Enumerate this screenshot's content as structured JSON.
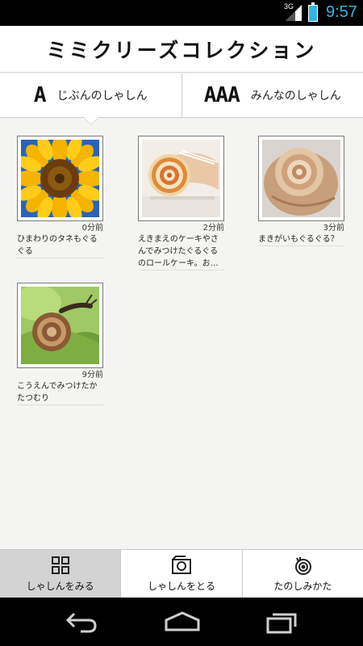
{
  "status": {
    "network": "3G",
    "time": "9:57"
  },
  "app": {
    "title": "ミミクリーズコレクション"
  },
  "tabs": [
    {
      "glyph": "A",
      "label": "じぶんのしゃしん"
    },
    {
      "glyph": "AAA",
      "label": "みんなのしゃしん"
    }
  ],
  "posts": [
    {
      "time": "0分前",
      "caption": "ひまわりのタネもぐるぐる",
      "photo": "sunflower"
    },
    {
      "time": "2分前",
      "caption": "えきまえのケーキやさんでみつけたぐるぐるのロールケーキ。お…",
      "photo": "roll-cake"
    },
    {
      "time": "3分前",
      "caption": "まきがいもぐるぐる？",
      "photo": "seashell"
    },
    {
      "time": "9分前",
      "caption": "こうえんでみつけたかたつむり",
      "photo": "snail"
    }
  ],
  "bottom_tabs": [
    {
      "label": "しゃしんをみる",
      "icon": "grid-icon",
      "active": true
    },
    {
      "label": "しゃしんをとる",
      "icon": "camera-icon",
      "active": false
    },
    {
      "label": "たのしみかた",
      "icon": "snail-icon",
      "active": false
    }
  ],
  "colors": {
    "accent": "#33b5e5",
    "active_tab": "#d3d3d3"
  }
}
